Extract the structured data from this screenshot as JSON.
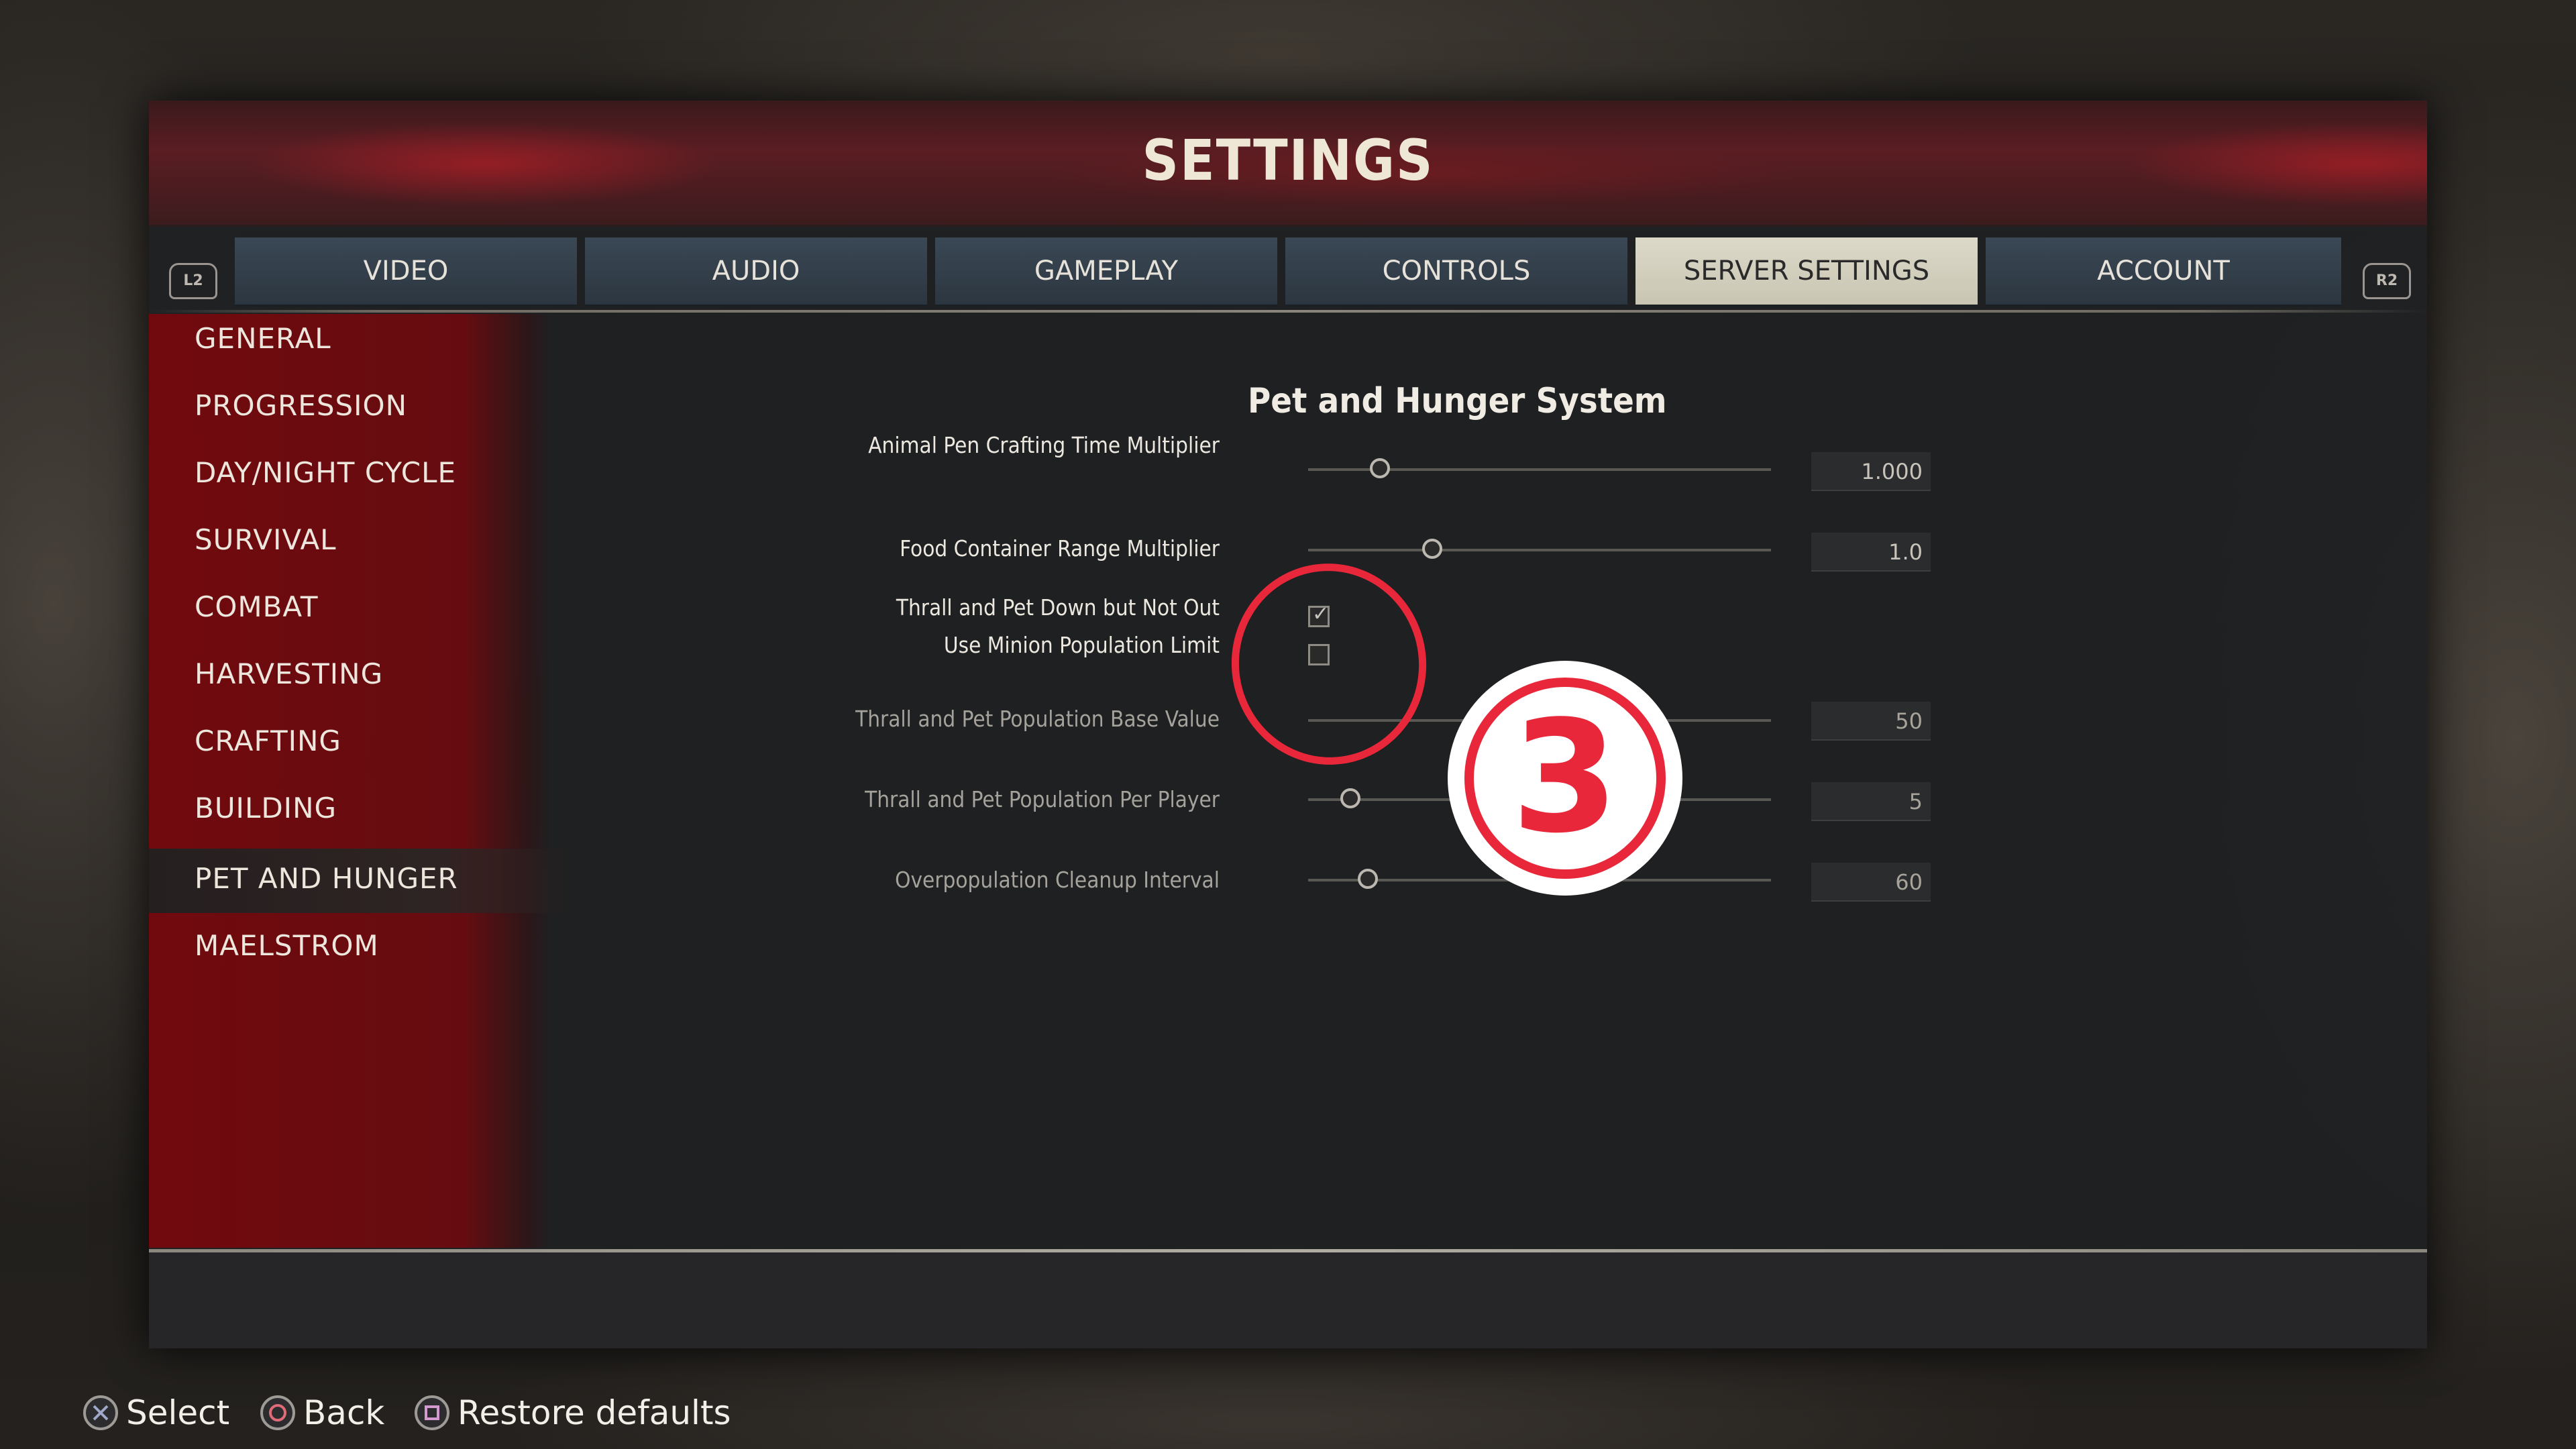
{
  "title": "SETTINGS",
  "bumpers": {
    "left": "L2",
    "right": "R2"
  },
  "tabs": [
    {
      "label": "VIDEO"
    },
    {
      "label": "AUDIO"
    },
    {
      "label": "GAMEPLAY"
    },
    {
      "label": "CONTROLS"
    },
    {
      "label": "SERVER SETTINGS",
      "active": true
    },
    {
      "label": "ACCOUNT"
    }
  ],
  "sidebar": {
    "items": [
      {
        "label": "GENERAL"
      },
      {
        "label": "PROGRESSION"
      },
      {
        "label": "DAY/NIGHT CYCLE"
      },
      {
        "label": "SURVIVAL"
      },
      {
        "label": "COMBAT"
      },
      {
        "label": "HARVESTING"
      },
      {
        "label": "CRAFTING"
      },
      {
        "label": "BUILDING"
      },
      {
        "label": "PET AND HUNGER",
        "active": true
      },
      {
        "label": "MAELSTROM"
      }
    ]
  },
  "section": {
    "title": "Pet and Hunger System",
    "settings": [
      {
        "label": "Animal Pen Crafting Time Multiplier",
        "type": "slider",
        "value": "1.000",
        "enabled": true
      },
      {
        "label": "Food Container Range Multiplier",
        "type": "slider",
        "value": "1.0",
        "enabled": true
      },
      {
        "label": "Thrall and Pet Down but Not Out",
        "type": "checkbox",
        "checked": true,
        "enabled": true
      },
      {
        "label": "Use Minion Population Limit",
        "type": "checkbox",
        "checked": false,
        "enabled": true
      },
      {
        "label": "Thrall and Pet Population Base Value",
        "type": "slider",
        "value": "50",
        "enabled": false
      },
      {
        "label": "Thrall and Pet Population Per Player",
        "type": "slider",
        "value": "5",
        "enabled": false
      },
      {
        "label": "Overpopulation Cleanup Interval",
        "type": "slider",
        "value": "60",
        "enabled": false
      }
    ]
  },
  "annotation": {
    "number": "3",
    "color": "#e8283a"
  },
  "footer": {
    "hints": [
      {
        "icon": "cross-button-icon",
        "label": "Select"
      },
      {
        "icon": "circle-button-icon",
        "label": "Back"
      },
      {
        "icon": "square-button-icon",
        "label": "Restore defaults"
      }
    ]
  },
  "colors": {
    "accent_red": "#7a0a0e",
    "tab_blue": "#34414d",
    "tab_active": "#d6d3c2"
  }
}
